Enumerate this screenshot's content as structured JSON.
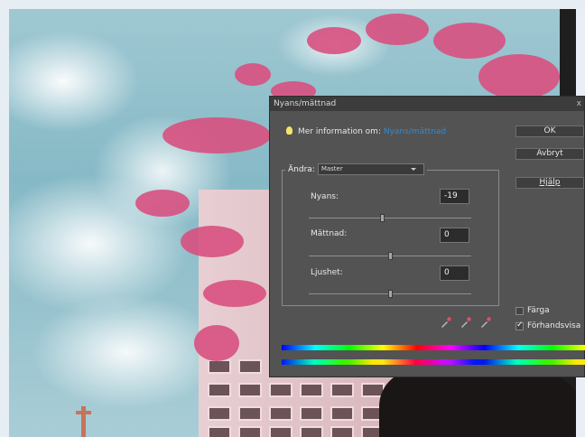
{
  "dialog": {
    "title": "Nyans/mättnad",
    "close_glyph": "x",
    "info_prefix": "Mer information om:",
    "info_link": "Nyans/mättnad",
    "buttons": {
      "ok": "OK",
      "cancel": "Avbryt",
      "help": "Hjälp"
    },
    "edit_label": "Ändra:",
    "edit_value": "Master",
    "sliders": [
      {
        "label": "Nyans:",
        "value": "-19",
        "level": -19,
        "min": -180,
        "max": 180
      },
      {
        "label": "Mättnad:",
        "value": "0",
        "level": 0,
        "min": -100,
        "max": 100
      },
      {
        "label": "Ljushet:",
        "value": "0",
        "level": 0,
        "min": -100,
        "max": 100
      }
    ],
    "checkboxes": [
      {
        "label": "Färga",
        "checked": false
      },
      {
        "label": "Förhandsvisa",
        "checked": true
      }
    ],
    "icons": [
      "eyedropper-icon",
      "eyedropper-plus-icon",
      "eyedropper-minus-icon",
      "bulb-icon"
    ]
  },
  "colors": {
    "dialog_bg": "#535353",
    "link": "#2e8bd8",
    "blossom": "#d8507f"
  }
}
